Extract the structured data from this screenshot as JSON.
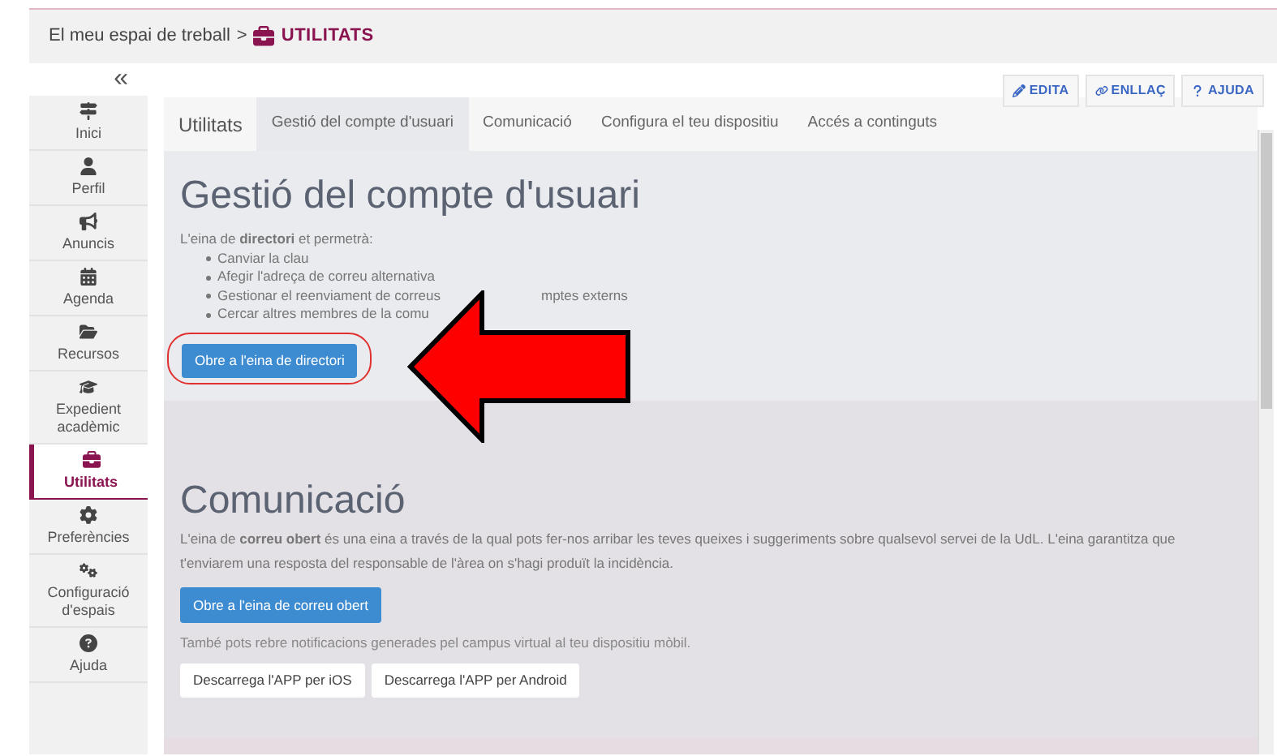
{
  "breadcrumb": {
    "parent": "El meu espai de treball",
    "separator": ">",
    "current": "UTILITATS"
  },
  "sidebar": {
    "collapse": "«",
    "items": [
      {
        "label": "Inici",
        "selected": false
      },
      {
        "label": "Perfil",
        "selected": false
      },
      {
        "label": "Anuncis",
        "selected": false
      },
      {
        "label": "Agenda",
        "selected": false
      },
      {
        "label": "Recursos",
        "selected": false
      },
      {
        "label": "Expedient acadèmic",
        "selected": false
      },
      {
        "label": "Utilitats",
        "selected": true
      },
      {
        "label": "Preferències",
        "selected": false
      },
      {
        "label": "Configuració d'espais",
        "selected": false
      },
      {
        "label": "Ajuda",
        "selected": false
      }
    ]
  },
  "toolbar": [
    {
      "label": "EDITA"
    },
    {
      "label": "ENLLAÇ"
    },
    {
      "label": "AJUDA"
    }
  ],
  "tabs": [
    {
      "label": "Utilitats",
      "selected": false,
      "kind": "title"
    },
    {
      "label": "Gestió del compte d'usuari",
      "selected": true,
      "kind": "tab"
    },
    {
      "label": "Comunicació",
      "selected": false,
      "kind": "tab"
    },
    {
      "label": "Configura el teu dispositiu",
      "selected": false,
      "kind": "tab"
    },
    {
      "label": "Accés a continguts",
      "selected": false,
      "kind": "tab"
    }
  ],
  "account_section": {
    "heading": "Gestió del compte d'usuari",
    "intro": "L'eina de **directori** et permetrà:",
    "items": [
      {
        "before": "Canviar la clau"
      },
      {
        "before": "Afegir l'adreça de correu alternativa"
      },
      {
        "before": "Gestionar el reenviament de correus",
        "after": "mptes externs"
      },
      {
        "before": "Cercar altres membres de la comu"
      }
    ],
    "button": "Obre a l'eina de directori",
    "highlighted": true
  },
  "communication_section": {
    "heading": "Comunicació",
    "text": "L'eina de **correu obert** és una eina a través de la qual pots fer-nos arribar les teves queixes i suggeriments sobre qualsevol servei de la UdL. L'eina garantitza que t'enviarem una resposta del responsable de l'àrea on s'hagi produït la incidència.",
    "button": "Obre a l'eina de correu obert",
    "note": "També pots rebre notificacions generades pel campus virtual al teu dispositiu mòbil.",
    "app_buttons": [
      "Descarrega l'APP per iOS",
      "Descarrega l'APP per Android"
    ]
  }
}
